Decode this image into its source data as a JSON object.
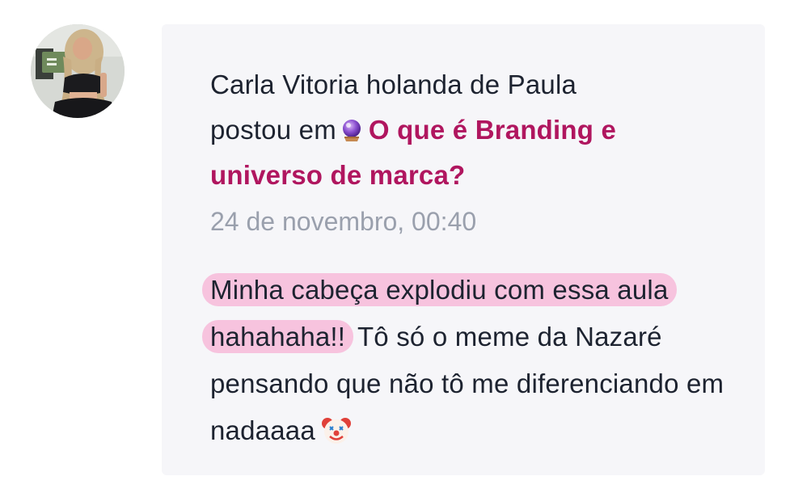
{
  "post": {
    "author": "Carla Vitoria holanda de Paula",
    "verb": "postou em",
    "topic_icon": "crystal-ball-icon",
    "topic_title": "O que é Branding e universo de marca?",
    "timestamp": "24 de novembro, 00:40",
    "comment_highlighted": "Minha cabeça explodiu com essa aula hahahaha!!",
    "comment_rest": "Tô só o meme da Nazaré pensando que não tô me diferenciando em nadaaaa",
    "comment_emoji": "clown-face-icon"
  },
  "colors": {
    "card_background": "#f6f6f9",
    "text": "#1d2330",
    "link": "#b0165f",
    "timestamp": "#9aa0ad",
    "highlight": "#f7c3de"
  }
}
